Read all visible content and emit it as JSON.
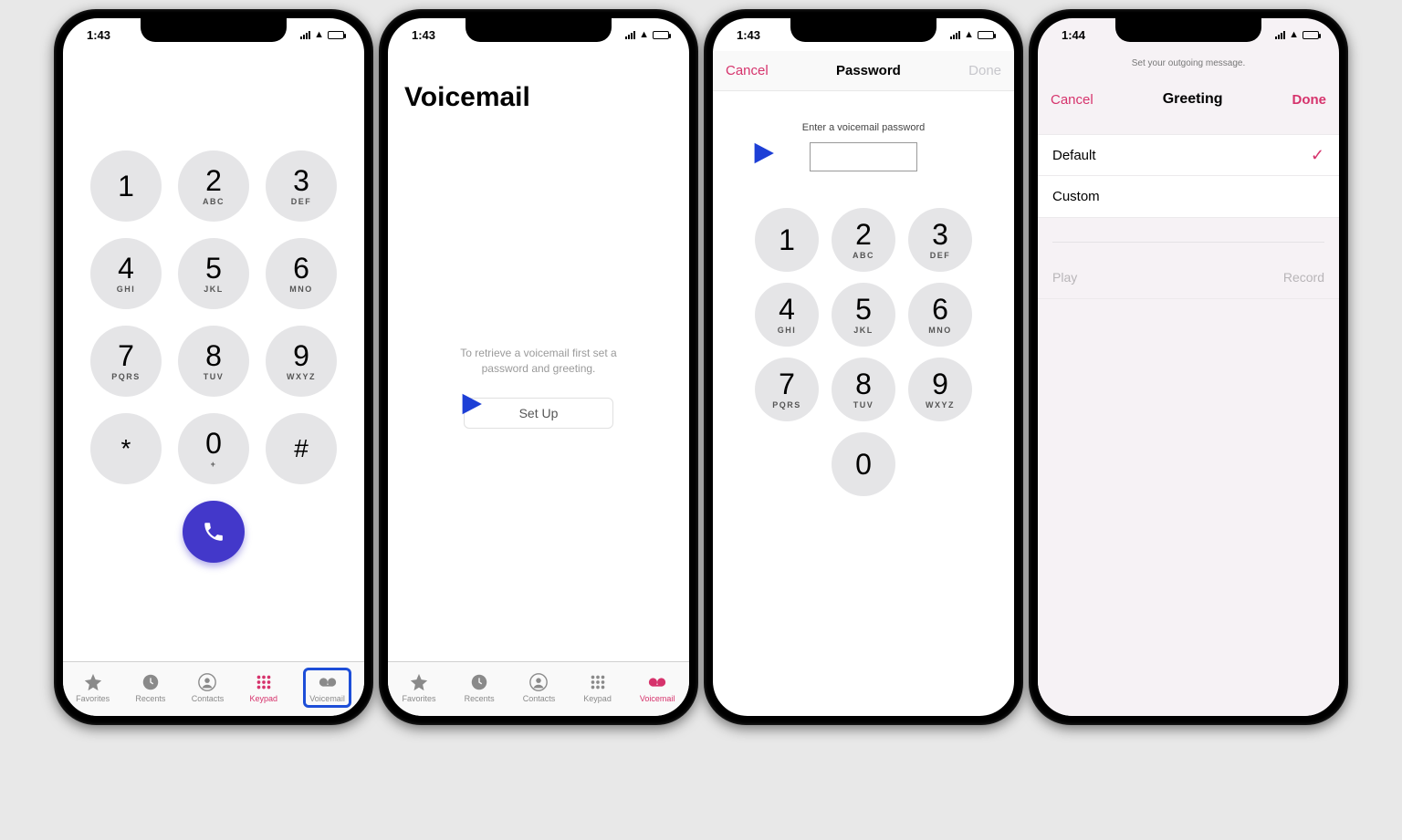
{
  "status": {
    "time1": "1:43",
    "time2": "1:43",
    "time3": "1:43",
    "time4": "1:44"
  },
  "keypad": {
    "keys": [
      {
        "n": "1",
        "l": ""
      },
      {
        "n": "2",
        "l": "ABC"
      },
      {
        "n": "3",
        "l": "DEF"
      },
      {
        "n": "4",
        "l": "GHI"
      },
      {
        "n": "5",
        "l": "JKL"
      },
      {
        "n": "6",
        "l": "MNO"
      },
      {
        "n": "7",
        "l": "PQRS"
      },
      {
        "n": "8",
        "l": "TUV"
      },
      {
        "n": "9",
        "l": "WXYZ"
      },
      {
        "n": "*",
        "l": ""
      },
      {
        "n": "0",
        "l": "+"
      },
      {
        "n": "#",
        "l": ""
      }
    ]
  },
  "pin_keys": [
    {
      "n": "1",
      "l": ""
    },
    {
      "n": "2",
      "l": "ABC"
    },
    {
      "n": "3",
      "l": "DEF"
    },
    {
      "n": "4",
      "l": "GHI"
    },
    {
      "n": "5",
      "l": "JKL"
    },
    {
      "n": "6",
      "l": "MNO"
    },
    {
      "n": "7",
      "l": "PQRS"
    },
    {
      "n": "8",
      "l": "TUV"
    },
    {
      "n": "9",
      "l": "WXYZ"
    },
    {
      "n": "0",
      "l": ""
    }
  ],
  "tabs": [
    {
      "label": "Favorites"
    },
    {
      "label": "Recents"
    },
    {
      "label": "Contacts"
    },
    {
      "label": "Keypad"
    },
    {
      "label": "Voicemail"
    }
  ],
  "screen2": {
    "title": "Voicemail",
    "msg_line1": "To retrieve a voicemail first set a",
    "msg_line2": "password and greeting.",
    "setup": "Set Up"
  },
  "screen3": {
    "cancel": "Cancel",
    "title": "Password",
    "done": "Done",
    "prompt": "Enter a voicemail password"
  },
  "screen4": {
    "top": "Set your outgoing message.",
    "cancel": "Cancel",
    "title": "Greeting",
    "done": "Done",
    "opt1": "Default",
    "opt2": "Custom",
    "play": "Play",
    "record": "Record"
  }
}
